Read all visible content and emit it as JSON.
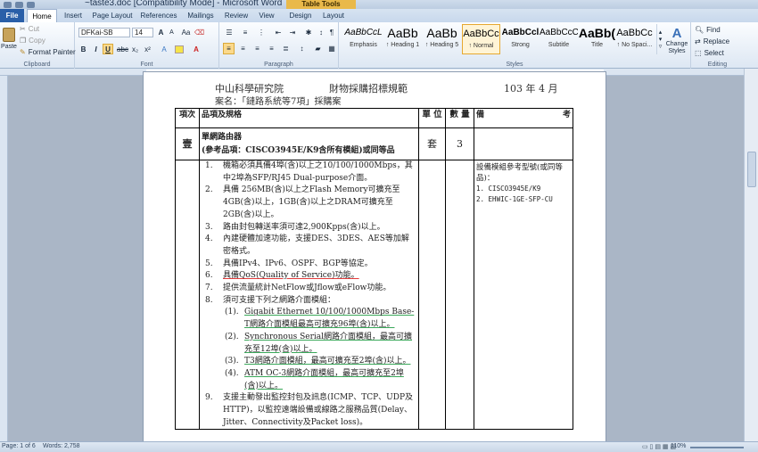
{
  "window": {
    "title": "~taste3.doc [Compatibility Mode] - Microsoft Word",
    "context_tab": "Table Tools"
  },
  "tabs": [
    "File",
    "Home",
    "Insert",
    "Page Layout",
    "References",
    "Mailings",
    "Review",
    "View",
    "Design",
    "Layout"
  ],
  "ribbon": {
    "clipboard": {
      "paste": "Paste",
      "cut": "Cut",
      "copy": "Copy",
      "format_painter": "Format Painter",
      "label": "Clipboard"
    },
    "font": {
      "name": "DFKai-SB",
      "size": "14",
      "label": "Font"
    },
    "paragraph": {
      "label": "Paragraph"
    },
    "styles": {
      "label": "Styles",
      "items": [
        {
          "sample": "AaBbCcL",
          "name": "Emphasis"
        },
        {
          "sample": "AaBb",
          "name": "↑ Heading 1"
        },
        {
          "sample": "AaBb",
          "name": "↑ Heading 5"
        },
        {
          "sample": "AaBbCc",
          "name": "↑ Normal"
        },
        {
          "sample": "AaBbCcl",
          "name": "Strong"
        },
        {
          "sample": "AaBbCcC",
          "name": "Subtitle"
        },
        {
          "sample": "AaBb(",
          "name": "Title"
        },
        {
          "sample": "AaBbCc",
          "name": "↑ No Spaci..."
        }
      ],
      "change": "Change Styles"
    },
    "editing": {
      "find": "Find",
      "replace": "Replace",
      "select": "Select",
      "label": "Editing"
    }
  },
  "doc": {
    "header_left": "中山科學研究院",
    "header_mid": "財物採購招標規範",
    "header_date": "103 年 4 月",
    "case": "案名：「鏈路系統等7項」採購案",
    "col_item": "項次",
    "col_name": "品項及規格",
    "col_unit": "單 位",
    "col_qty": "數 量",
    "col_note": "備",
    "col_note2": "考",
    "item_no": "壹",
    "item_title1": "單網路由器",
    "item_title2": "(參考品項：CISCO3945E/K9含所有模組)或同等品",
    "unit": "套",
    "qty": "3",
    "note_title": "設備模組參考型號(或同等品)：",
    "notes": [
      "1.  CISCO3945E/K9",
      "2.  EHWIC-1GE-SFP-CU"
    ],
    "specs": [
      {
        "n": "1.",
        "t": "機箱必須具備4埠(含)以上之10/100/1000Mbps，其中2埠為SFP/RJ45 Dual-purpose介面。"
      },
      {
        "n": "2.",
        "t": "具備 256MB(含)以上之Flash Memory可擴充至4GB(含)以上，1GB(含)以上之DRAM可擴充至2GB(含)以上。"
      },
      {
        "n": "3.",
        "t": "路由封包轉送率須可達2,900Kpps(含)以上。"
      },
      {
        "n": "4.",
        "t": "內建硬體加速功能，支援DES、3DES、AES等加解密格式。"
      },
      {
        "n": "5.",
        "t": "具備IPv4、IPv6、OSPF、BGP等協定。"
      },
      {
        "n": "6.",
        "t": "具備QoS(Quality of Service)功能。"
      },
      {
        "n": "7.",
        "t": "提供流量統計NetFlow或Jflow或eFlow功能。"
      },
      {
        "n": "8.",
        "t": "須可支援下列之網路介面模組："
      }
    ],
    "subs": [
      {
        "n": "(1).",
        "t": "Gigabit Ethernet 10/100/1000Mbps Base-T網路介面模組最高可擴充96埠(含)以上。"
      },
      {
        "n": "(2).",
        "t": "Synchronous Serial網路介面模組，最高可擴充至12埠(含)以上。"
      },
      {
        "n": "(3).",
        "t": "T3網路介面模組，最高可擴充至2埠(含)以上。"
      },
      {
        "n": "(4).",
        "t": "ATM OC-3網路介面模組，最高可擴充至2埠(含)以上。"
      }
    ],
    "spec9": {
      "n": "9.",
      "t": "支援主動發出監控封包及訊息(ICMP、TCP、UDP及HTTP)，以監控遠端設備或線路之服務品質(Delay、Jitter、Connectivity及Packet loss)。"
    }
  },
  "status": {
    "page": "Page: 1 of 6",
    "words": "Words: 2,758",
    "zoom": "110%"
  }
}
